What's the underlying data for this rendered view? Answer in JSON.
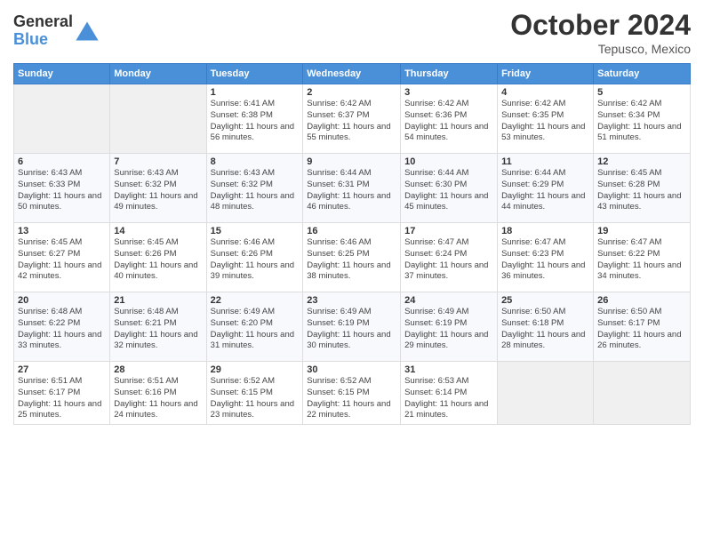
{
  "header": {
    "logo_line1": "General",
    "logo_line2": "Blue",
    "month": "October 2024",
    "location": "Tepusco, Mexico"
  },
  "weekdays": [
    "Sunday",
    "Monday",
    "Tuesday",
    "Wednesday",
    "Thursday",
    "Friday",
    "Saturday"
  ],
  "weeks": [
    [
      {
        "day": "",
        "info": ""
      },
      {
        "day": "",
        "info": ""
      },
      {
        "day": "1",
        "info": "Sunrise: 6:41 AM\nSunset: 6:38 PM\nDaylight: 11 hours and 56 minutes."
      },
      {
        "day": "2",
        "info": "Sunrise: 6:42 AM\nSunset: 6:37 PM\nDaylight: 11 hours and 55 minutes."
      },
      {
        "day": "3",
        "info": "Sunrise: 6:42 AM\nSunset: 6:36 PM\nDaylight: 11 hours and 54 minutes."
      },
      {
        "day": "4",
        "info": "Sunrise: 6:42 AM\nSunset: 6:35 PM\nDaylight: 11 hours and 53 minutes."
      },
      {
        "day": "5",
        "info": "Sunrise: 6:42 AM\nSunset: 6:34 PM\nDaylight: 11 hours and 51 minutes."
      }
    ],
    [
      {
        "day": "6",
        "info": "Sunrise: 6:43 AM\nSunset: 6:33 PM\nDaylight: 11 hours and 50 minutes."
      },
      {
        "day": "7",
        "info": "Sunrise: 6:43 AM\nSunset: 6:32 PM\nDaylight: 11 hours and 49 minutes."
      },
      {
        "day": "8",
        "info": "Sunrise: 6:43 AM\nSunset: 6:32 PM\nDaylight: 11 hours and 48 minutes."
      },
      {
        "day": "9",
        "info": "Sunrise: 6:44 AM\nSunset: 6:31 PM\nDaylight: 11 hours and 46 minutes."
      },
      {
        "day": "10",
        "info": "Sunrise: 6:44 AM\nSunset: 6:30 PM\nDaylight: 11 hours and 45 minutes."
      },
      {
        "day": "11",
        "info": "Sunrise: 6:44 AM\nSunset: 6:29 PM\nDaylight: 11 hours and 44 minutes."
      },
      {
        "day": "12",
        "info": "Sunrise: 6:45 AM\nSunset: 6:28 PM\nDaylight: 11 hours and 43 minutes."
      }
    ],
    [
      {
        "day": "13",
        "info": "Sunrise: 6:45 AM\nSunset: 6:27 PM\nDaylight: 11 hours and 42 minutes."
      },
      {
        "day": "14",
        "info": "Sunrise: 6:45 AM\nSunset: 6:26 PM\nDaylight: 11 hours and 40 minutes."
      },
      {
        "day": "15",
        "info": "Sunrise: 6:46 AM\nSunset: 6:26 PM\nDaylight: 11 hours and 39 minutes."
      },
      {
        "day": "16",
        "info": "Sunrise: 6:46 AM\nSunset: 6:25 PM\nDaylight: 11 hours and 38 minutes."
      },
      {
        "day": "17",
        "info": "Sunrise: 6:47 AM\nSunset: 6:24 PM\nDaylight: 11 hours and 37 minutes."
      },
      {
        "day": "18",
        "info": "Sunrise: 6:47 AM\nSunset: 6:23 PM\nDaylight: 11 hours and 36 minutes."
      },
      {
        "day": "19",
        "info": "Sunrise: 6:47 AM\nSunset: 6:22 PM\nDaylight: 11 hours and 34 minutes."
      }
    ],
    [
      {
        "day": "20",
        "info": "Sunrise: 6:48 AM\nSunset: 6:22 PM\nDaylight: 11 hours and 33 minutes."
      },
      {
        "day": "21",
        "info": "Sunrise: 6:48 AM\nSunset: 6:21 PM\nDaylight: 11 hours and 32 minutes."
      },
      {
        "day": "22",
        "info": "Sunrise: 6:49 AM\nSunset: 6:20 PM\nDaylight: 11 hours and 31 minutes."
      },
      {
        "day": "23",
        "info": "Sunrise: 6:49 AM\nSunset: 6:19 PM\nDaylight: 11 hours and 30 minutes."
      },
      {
        "day": "24",
        "info": "Sunrise: 6:49 AM\nSunset: 6:19 PM\nDaylight: 11 hours and 29 minutes."
      },
      {
        "day": "25",
        "info": "Sunrise: 6:50 AM\nSunset: 6:18 PM\nDaylight: 11 hours and 28 minutes."
      },
      {
        "day": "26",
        "info": "Sunrise: 6:50 AM\nSunset: 6:17 PM\nDaylight: 11 hours and 26 minutes."
      }
    ],
    [
      {
        "day": "27",
        "info": "Sunrise: 6:51 AM\nSunset: 6:17 PM\nDaylight: 11 hours and 25 minutes."
      },
      {
        "day": "28",
        "info": "Sunrise: 6:51 AM\nSunset: 6:16 PM\nDaylight: 11 hours and 24 minutes."
      },
      {
        "day": "29",
        "info": "Sunrise: 6:52 AM\nSunset: 6:15 PM\nDaylight: 11 hours and 23 minutes."
      },
      {
        "day": "30",
        "info": "Sunrise: 6:52 AM\nSunset: 6:15 PM\nDaylight: 11 hours and 22 minutes."
      },
      {
        "day": "31",
        "info": "Sunrise: 6:53 AM\nSunset: 6:14 PM\nDaylight: 11 hours and 21 minutes."
      },
      {
        "day": "",
        "info": ""
      },
      {
        "day": "",
        "info": ""
      }
    ]
  ]
}
